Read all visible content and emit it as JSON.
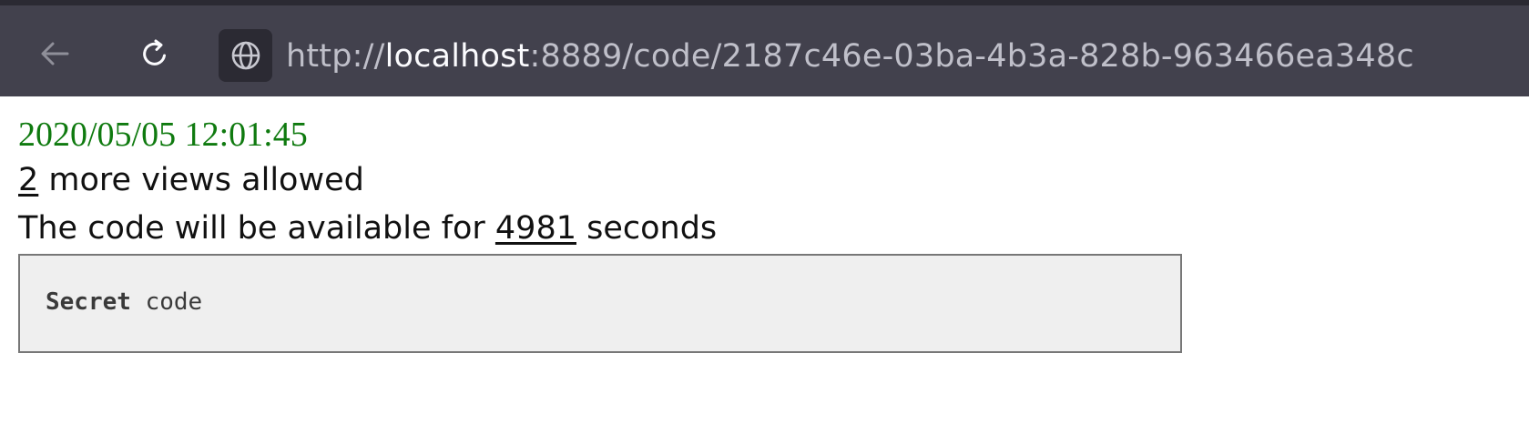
{
  "browser": {
    "url": {
      "scheme": "http://",
      "host": "localhost",
      "rest": ":8889/code/2187c46e-03ba-4b3a-828b-963466ea348c"
    },
    "icons": {
      "back": "arrow-left-icon",
      "reload": "reload-icon",
      "site": "globe-icon"
    },
    "colors": {
      "toolbar": "#42414d",
      "identity_box": "#2b2a33"
    }
  },
  "page": {
    "timestamp": "2020/05/05 12:01:45",
    "views_count": "2",
    "views_text": " more views allowed",
    "seconds_prefix": "The code will be available for ",
    "seconds_value": "4981",
    "seconds_suffix": " seconds",
    "code_keyword": "Secret",
    "code_rest": " code",
    "colors": {
      "timestamp": "#0f7a0f",
      "code_background": "#efefef"
    }
  }
}
